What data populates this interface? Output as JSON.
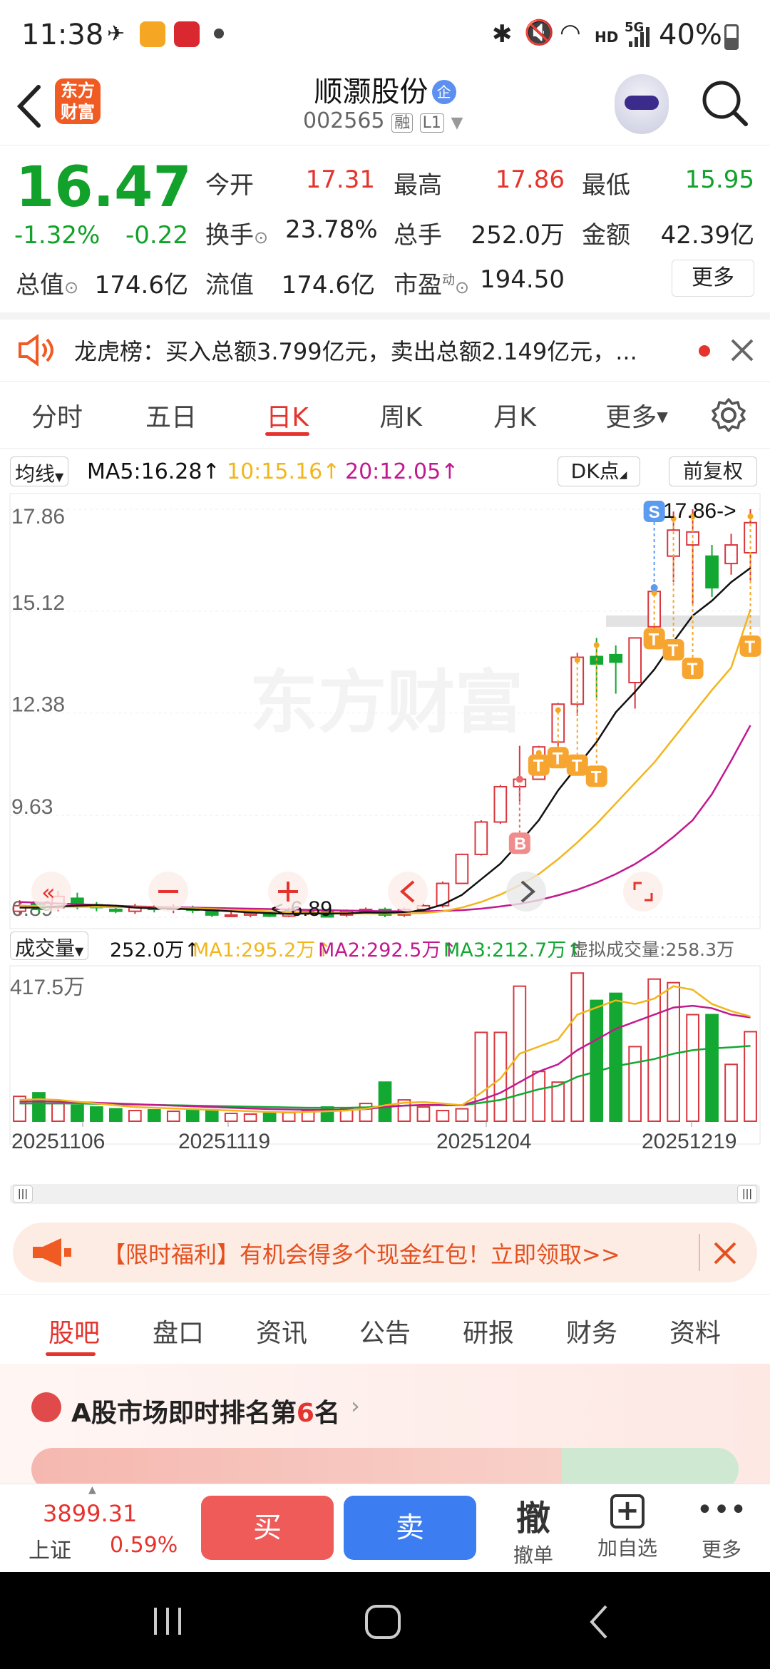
{
  "status": {
    "time": "11:38",
    "battery": "40%",
    "network": "5G",
    "hd": "HD"
  },
  "header": {
    "logo_line1": "东方",
    "logo_line2": "财富",
    "stock_name": "顺灏股份",
    "badge": "企",
    "stock_code": "002565",
    "tag_margin": "融",
    "tag_level": "L1"
  },
  "quote": {
    "price": "16.47",
    "change_pct": "-1.32%",
    "change_amt": "-0.22",
    "open_label": "今开",
    "open": "17.31",
    "high_label": "最高",
    "high": "17.86",
    "low_label": "最低",
    "low": "15.95",
    "turnover_label": "换手",
    "turnover": "23.78%",
    "volume_label": "总手",
    "volume": "252.0万",
    "amount_label": "金额",
    "amount": "42.39亿",
    "mktcap_label": "总值",
    "mktcap": "174.6亿",
    "float_label": "流值",
    "float": "174.6亿",
    "pe_label": "市盈",
    "pe_sup": "动",
    "pe": "194.50",
    "more": "更多"
  },
  "notice": {
    "text": "龙虎榜：买入总额3.799亿元，卖出总额2.149亿元，..."
  },
  "ktabs": [
    "分时",
    "五日",
    "日K",
    "周K",
    "月K",
    "更多"
  ],
  "chart_toolbar": {
    "ma_selector": "均线",
    "ma5": "MA5:16.28",
    "ma10": "10:15.16",
    "ma20": "20:12.05",
    "dk_button": "DK点",
    "adjust_button": "前复权"
  },
  "vol_toolbar": {
    "selector": "成交量",
    "vol": "252.0万",
    "ma1": "MA1:295.2万",
    "ma2": "MA2:292.5万",
    "ma3": "MA3:212.7万",
    "virtual": "虚拟成交量:258.3万"
  },
  "watermark": "东方财富",
  "chart_data": {
    "type": "candlestick",
    "y_ticks": [
      "17.86",
      "15.12",
      "12.38",
      "9.63",
      "6.89"
    ],
    "ylim": [
      6.89,
      17.86
    ],
    "x_ticks": [
      "20251106",
      "20251119",
      "20251204",
      "20251219"
    ],
    "high_marker": "17.86->",
    "low_marker": "<-6.89",
    "vol_top_label": "417.5万",
    "vol_max": 417.5,
    "signal_S": "S",
    "signal_B": "B",
    "signal_T": "T",
    "colors": {
      "up": "#d9363e",
      "down": "#13a832",
      "ma5": "#111111",
      "ma10": "#f2b61c",
      "ma20": "#c2198f"
    },
    "candles": [
      {
        "o": 7.05,
        "c": 7.2,
        "h": 7.35,
        "l": 6.95,
        "v": 70
      },
      {
        "o": 7.25,
        "c": 7.1,
        "h": 7.3,
        "l": 7.0,
        "v": 80
      },
      {
        "o": 7.15,
        "c": 7.45,
        "h": 7.6,
        "l": 7.05,
        "v": 50
      },
      {
        "o": 7.4,
        "c": 7.2,
        "h": 7.55,
        "l": 7.1,
        "v": 45
      },
      {
        "o": 7.2,
        "c": 7.15,
        "h": 7.3,
        "l": 7.05,
        "v": 40
      },
      {
        "o": 7.1,
        "c": 7.05,
        "h": 7.2,
        "l": 7.0,
        "v": 35
      },
      {
        "o": 7.05,
        "c": 7.15,
        "h": 7.25,
        "l": 6.98,
        "v": 30
      },
      {
        "o": 7.15,
        "c": 7.1,
        "h": 7.22,
        "l": 7.02,
        "v": 32
      },
      {
        "o": 7.1,
        "c": 7.15,
        "h": 7.25,
        "l": 7.0,
        "v": 28
      },
      {
        "o": 7.12,
        "c": 7.08,
        "h": 7.2,
        "l": 7.0,
        "v": 30
      },
      {
        "o": 7.05,
        "c": 6.95,
        "h": 7.15,
        "l": 6.9,
        "v": 30
      },
      {
        "o": 6.95,
        "c": 6.95,
        "h": 7.05,
        "l": 6.89,
        "v": 22
      },
      {
        "o": 6.95,
        "c": 7.0,
        "h": 7.1,
        "l": 6.89,
        "v": 20
      },
      {
        "o": 7.0,
        "c": 6.92,
        "h": 7.05,
        "l": 6.89,
        "v": 22
      },
      {
        "o": 6.92,
        "c": 7.05,
        "h": 7.15,
        "l": 6.89,
        "v": 24
      },
      {
        "o": 7.0,
        "c": 7.05,
        "h": 7.1,
        "l": 6.95,
        "v": 30
      },
      {
        "o": 7.05,
        "c": 6.9,
        "h": 7.1,
        "l": 6.89,
        "v": 40
      },
      {
        "o": 6.95,
        "c": 7.05,
        "h": 7.1,
        "l": 6.9,
        "v": 35
      },
      {
        "o": 7.05,
        "c": 7.1,
        "h": 7.15,
        "l": 7.0,
        "v": 50
      },
      {
        "o": 7.1,
        "c": 6.95,
        "h": 7.15,
        "l": 6.89,
        "v": 110
      },
      {
        "o": 6.95,
        "c": 7.1,
        "h": 7.15,
        "l": 6.9,
        "v": 60
      },
      {
        "o": 7.1,
        "c": 7.2,
        "h": 7.25,
        "l": 7.05,
        "v": 40
      },
      {
        "o": 7.2,
        "c": 7.8,
        "h": 7.85,
        "l": 7.15,
        "v": 30
      },
      {
        "o": 7.8,
        "c": 8.58,
        "h": 8.6,
        "l": 7.8,
        "v": 35
      },
      {
        "o": 8.58,
        "c": 9.45,
        "h": 9.5,
        "l": 8.55,
        "v": 250
      },
      {
        "o": 9.45,
        "c": 10.4,
        "h": 10.45,
        "l": 9.4,
        "v": 250
      },
      {
        "o": 10.4,
        "c": 10.6,
        "h": 11.5,
        "l": 10.0,
        "v": 380
      },
      {
        "o": 10.6,
        "c": 11.47,
        "h": 11.5,
        "l": 10.6,
        "v": 140
      },
      {
        "o": 11.6,
        "c": 12.62,
        "h": 12.65,
        "l": 11.4,
        "v": 110
      },
      {
        "o": 12.62,
        "c": 13.88,
        "h": 14.0,
        "l": 12.3,
        "v": 417
      },
      {
        "o": 13.9,
        "c": 13.7,
        "h": 14.4,
        "l": 12.8,
        "v": 340
      },
      {
        "o": 13.95,
        "c": 13.75,
        "h": 14.2,
        "l": 12.9,
        "v": 360
      },
      {
        "o": 13.2,
        "c": 14.4,
        "h": 14.4,
        "l": 12.5,
        "v": 210
      },
      {
        "o": 14.7,
        "c": 15.65,
        "h": 15.8,
        "l": 14.5,
        "v": 400
      },
      {
        "o": 16.6,
        "c": 17.3,
        "h": 17.8,
        "l": 15.9,
        "v": 390
      },
      {
        "o": 16.9,
        "c": 17.25,
        "h": 17.86,
        "l": 15.3,
        "v": 300
      },
      {
        "o": 16.6,
        "c": 15.75,
        "h": 16.9,
        "l": 15.5,
        "v": 300
      },
      {
        "o": 16.4,
        "c": 16.9,
        "h": 17.2,
        "l": 16.1,
        "v": 160
      },
      {
        "o": 16.69,
        "c": 17.5,
        "h": 17.86,
        "l": 15.95,
        "v": 252
      }
    ],
    "ma5": [
      7.15,
      7.15,
      7.18,
      7.2,
      7.22,
      7.2,
      7.15,
      7.13,
      7.12,
      7.1,
      7.08,
      7.05,
      7.02,
      7.0,
      6.98,
      6.99,
      6.99,
      6.99,
      7.02,
      7.01,
      7.03,
      7.08,
      7.23,
      7.49,
      7.91,
      8.33,
      8.9,
      9.5,
      10.3,
      10.95,
      11.6,
      12.4,
      12.95,
      13.55,
      14.3,
      15.0,
      15.4,
      15.9,
      16.28
    ],
    "ma10": [
      7.2,
      7.19,
      7.18,
      7.17,
      7.17,
      7.16,
      7.16,
      7.15,
      7.14,
      7.13,
      7.11,
      7.09,
      7.07,
      7.05,
      7.03,
      7.02,
      7.01,
      7.0,
      6.99,
      6.99,
      6.99,
      7.0,
      7.05,
      7.15,
      7.3,
      7.5,
      7.75,
      8.05,
      8.45,
      8.9,
      9.4,
      9.95,
      10.5,
      11.05,
      11.7,
      12.35,
      13.0,
      13.6,
      15.16
    ],
    "ma20": [
      7.3,
      7.28,
      7.26,
      7.24,
      7.22,
      7.2,
      7.18,
      7.17,
      7.16,
      7.15,
      7.14,
      7.13,
      7.12,
      7.11,
      7.1,
      7.09,
      7.08,
      7.07,
      7.06,
      7.05,
      7.05,
      7.05,
      7.06,
      7.08,
      7.12,
      7.18,
      7.25,
      7.35,
      7.48,
      7.63,
      7.82,
      8.05,
      8.32,
      8.65,
      9.05,
      9.5,
      10.2,
      11.1,
      12.05
    ],
    "vol_ma1": [
      60,
      62,
      60,
      55,
      50,
      45,
      40,
      38,
      36,
      34,
      32,
      30,
      28,
      26,
      25,
      26,
      28,
      30,
      35,
      45,
      52,
      54,
      50,
      45,
      80,
      120,
      190,
      210,
      230,
      300,
      320,
      340,
      330,
      345,
      380,
      370,
      330,
      310,
      295
    ],
    "vol_ma2": [
      55,
      56,
      55,
      54,
      52,
      50,
      48,
      46,
      44,
      42,
      40,
      38,
      36,
      34,
      33,
      32,
      32,
      32,
      34,
      40,
      44,
      46,
      46,
      45,
      60,
      80,
      110,
      140,
      160,
      200,
      230,
      260,
      280,
      300,
      320,
      325,
      318,
      300,
      292
    ],
    "vol_ma3": [
      50,
      50,
      50,
      50,
      49,
      48,
      47,
      46,
      45,
      44,
      43,
      42,
      41,
      40,
      39,
      38,
      38,
      38,
      39,
      42,
      44,
      45,
      45,
      45,
      52,
      60,
      75,
      90,
      100,
      125,
      140,
      155,
      165,
      175,
      190,
      200,
      205,
      208,
      212
    ]
  },
  "banner": {
    "text": "【限时福利】有机会得多个现金红包！立即领取>>"
  },
  "subtabs": [
    "股吧",
    "盘口",
    "资讯",
    "公告",
    "研报",
    "财务",
    "资料"
  ],
  "ranking": {
    "prefix": "A股市场即时排名第",
    "rank": "6",
    "suffix": "名"
  },
  "bottom": {
    "index_value": "3899.31",
    "index_name": "上证",
    "index_change": "0.59%",
    "buy": "买",
    "sell": "卖",
    "cancel_icon": "撤",
    "cancel": "撤单",
    "add": "加自选",
    "more": "更多"
  }
}
